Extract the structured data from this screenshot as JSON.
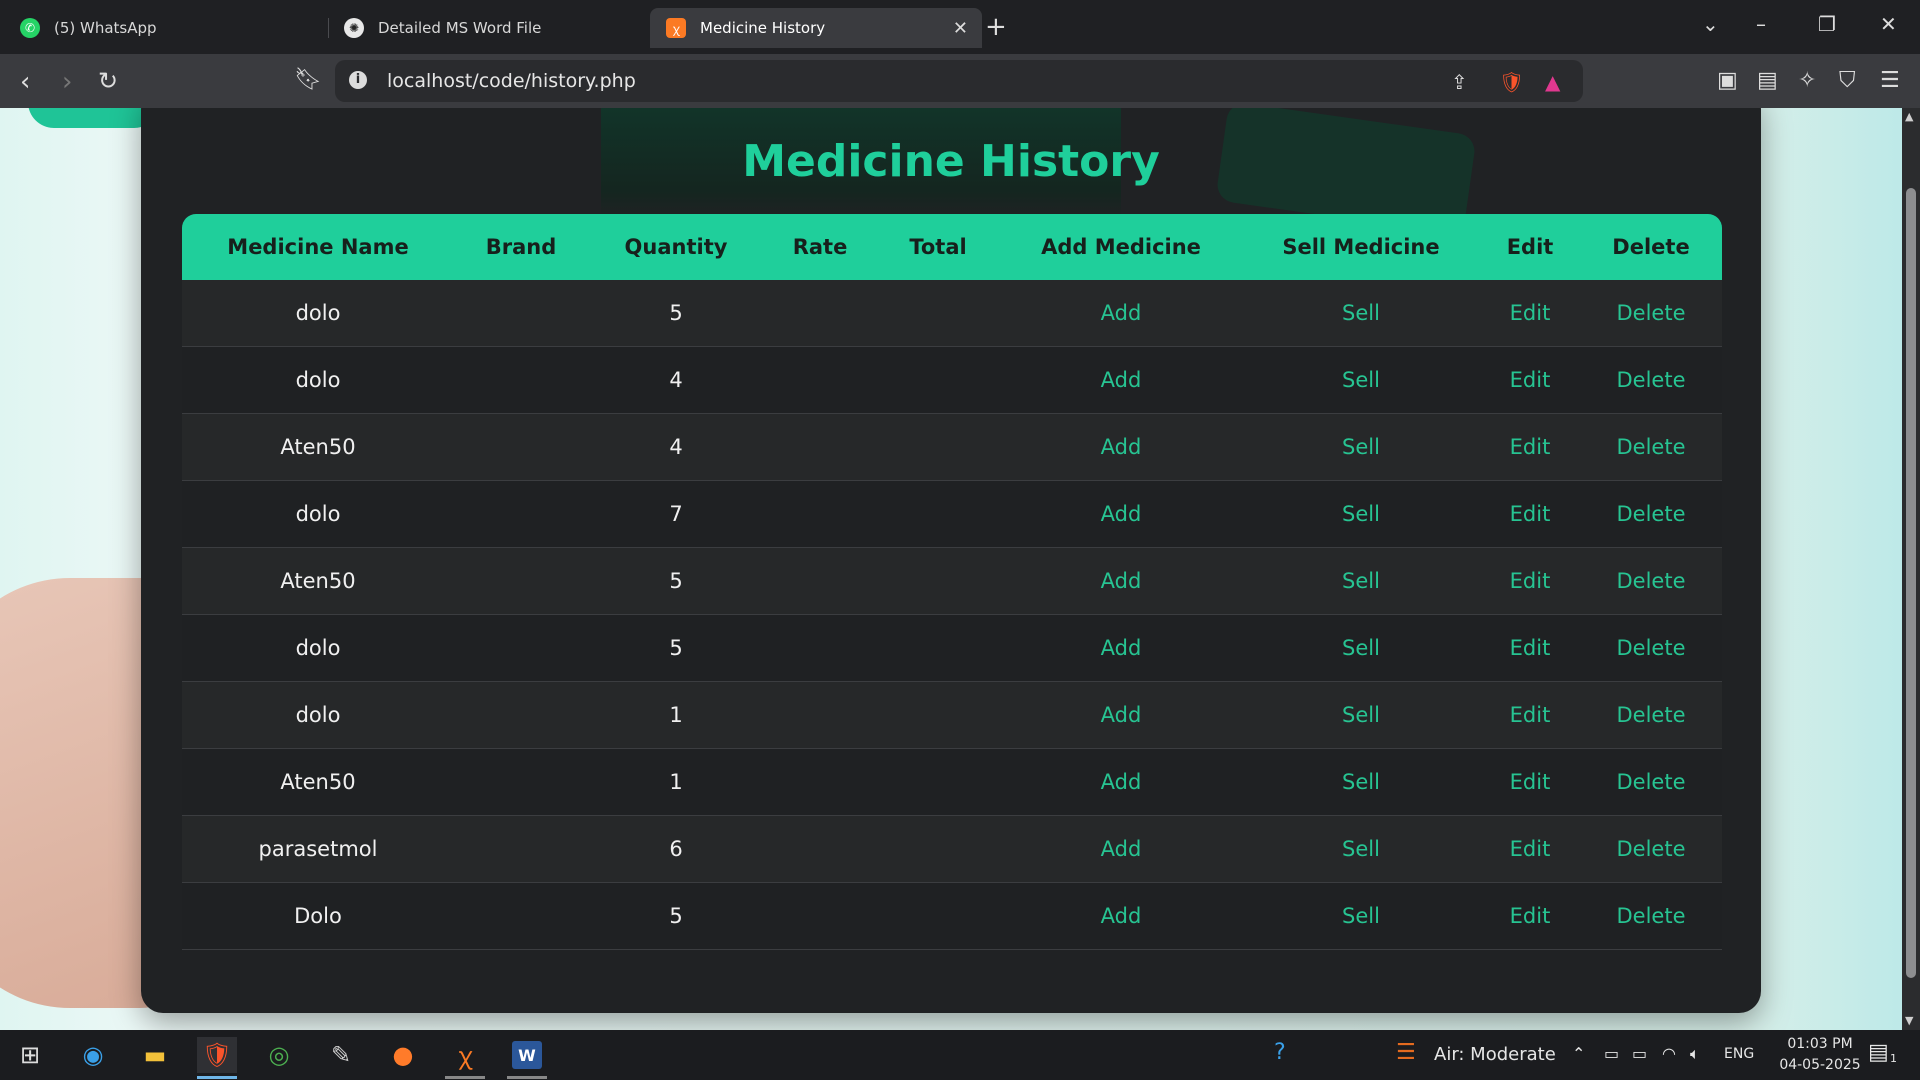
{
  "browser": {
    "tabs": [
      {
        "title": "(5) WhatsApp",
        "icon": "whatsapp-icon"
      },
      {
        "title": "Detailed MS Word File",
        "icon": "openai-icon"
      },
      {
        "title": "Medicine History",
        "icon": "xampp-icon",
        "active": true
      }
    ],
    "url": "localhost/code/history.php"
  },
  "page": {
    "title": "Medicine History",
    "columns": [
      "Medicine Name",
      "Brand",
      "Quantity",
      "Rate",
      "Total",
      "Add Medicine",
      "Sell Medicine",
      "Edit",
      "Delete"
    ],
    "rows": [
      {
        "name": "dolo",
        "brand": "",
        "quantity": "5",
        "rate": "",
        "total": "",
        "add": "Add",
        "sell": "Sell",
        "edit": "Edit",
        "delete": "Delete"
      },
      {
        "name": "dolo",
        "brand": "",
        "quantity": "4",
        "rate": "",
        "total": "",
        "add": "Add",
        "sell": "Sell",
        "edit": "Edit",
        "delete": "Delete"
      },
      {
        "name": "Aten50",
        "brand": "",
        "quantity": "4",
        "rate": "",
        "total": "",
        "add": "Add",
        "sell": "Sell",
        "edit": "Edit",
        "delete": "Delete"
      },
      {
        "name": "dolo",
        "brand": "",
        "quantity": "7",
        "rate": "",
        "total": "",
        "add": "Add",
        "sell": "Sell",
        "edit": "Edit",
        "delete": "Delete"
      },
      {
        "name": "Aten50",
        "brand": "",
        "quantity": "5",
        "rate": "",
        "total": "",
        "add": "Add",
        "sell": "Sell",
        "edit": "Edit",
        "delete": "Delete"
      },
      {
        "name": "dolo",
        "brand": "",
        "quantity": "5",
        "rate": "",
        "total": "",
        "add": "Add",
        "sell": "Sell",
        "edit": "Edit",
        "delete": "Delete"
      },
      {
        "name": "dolo",
        "brand": "",
        "quantity": "1",
        "rate": "",
        "total": "",
        "add": "Add",
        "sell": "Sell",
        "edit": "Edit",
        "delete": "Delete"
      },
      {
        "name": "Aten50",
        "brand": "",
        "quantity": "1",
        "rate": "",
        "total": "",
        "add": "Add",
        "sell": "Sell",
        "edit": "Edit",
        "delete": "Delete"
      },
      {
        "name": "parasetmol",
        "brand": "",
        "quantity": "6",
        "rate": "",
        "total": "",
        "add": "Add",
        "sell": "Sell",
        "edit": "Edit",
        "delete": "Delete"
      },
      {
        "name": "Dolo",
        "brand": "",
        "quantity": "5",
        "rate": "",
        "total": "",
        "add": "Add",
        "sell": "Sell",
        "edit": "Edit",
        "delete": "Delete"
      }
    ]
  },
  "taskbar": {
    "weather": "Air: Moderate",
    "language": "ENG",
    "time": "01:03 PM",
    "date": "04-05-2025",
    "notification_count": "1"
  },
  "colors": {
    "accent": "#1fcf9b",
    "card": "#202224",
    "link": "#27c492"
  }
}
